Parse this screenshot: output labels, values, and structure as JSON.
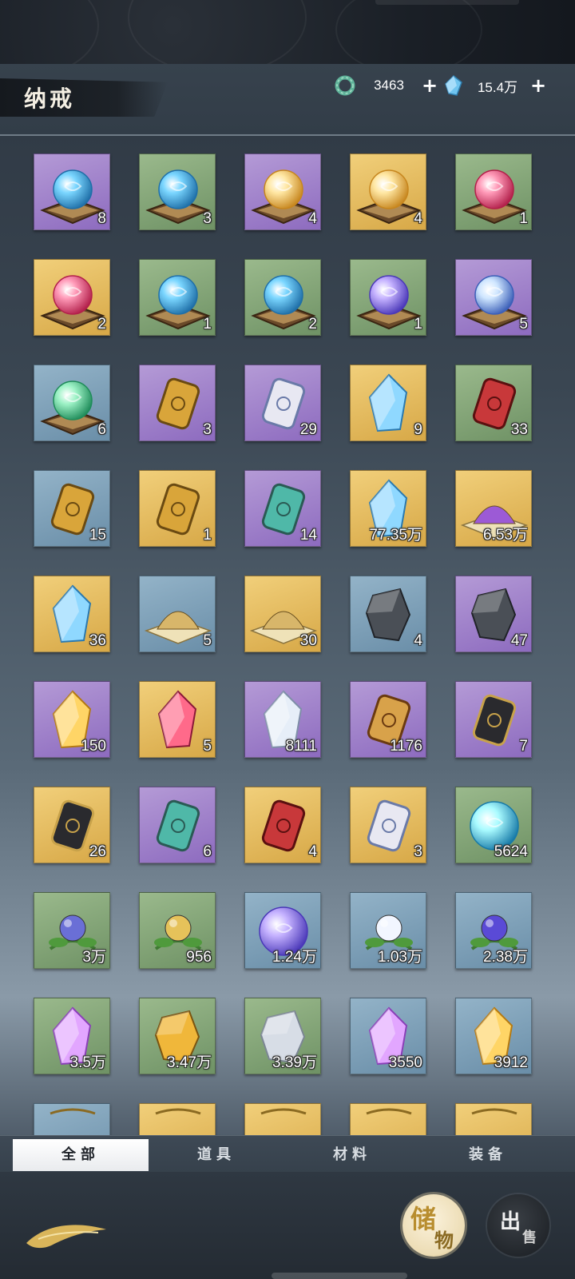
{
  "header": {
    "title": "纳戒",
    "currencies": [
      {
        "icon": "jade-ring-icon",
        "value": "3463"
      },
      {
        "icon": "blue-crystal-icon",
        "value": "15.4万"
      }
    ],
    "plus_label": "+"
  },
  "rows": [
    [
      {
        "bg": "purple",
        "icon": "blue-swirl-orb-icon",
        "count": "8"
      },
      {
        "bg": "green",
        "icon": "blue-orb-icon",
        "count": "3"
      },
      {
        "bg": "purple",
        "icon": "golden-lotus-orb-icon",
        "count": "4"
      },
      {
        "bg": "gold",
        "icon": "yin-yang-orb-icon",
        "count": "4"
      },
      {
        "bg": "green",
        "icon": "pink-swirl-orb-icon",
        "count": "1"
      }
    ],
    [
      {
        "bg": "gold",
        "icon": "red-sword-orb-icon",
        "count": "2"
      },
      {
        "bg": "green",
        "icon": "blue-shield-orb-icon",
        "count": "1"
      },
      {
        "bg": "green",
        "icon": "blue-shield-orb-icon",
        "count": "2"
      },
      {
        "bg": "green",
        "icon": "purple-rune-orb-icon",
        "count": "1"
      },
      {
        "bg": "purple",
        "icon": "meditation-orb-icon",
        "count": "5"
      }
    ],
    [
      {
        "bg": "blue",
        "icon": "green-swirl-orb-icon",
        "count": "6"
      },
      {
        "bg": "purple",
        "icon": "golden-bells-icon",
        "count": "3"
      },
      {
        "bg": "purple",
        "icon": "feather-charm-icon",
        "count": "29"
      },
      {
        "bg": "gold",
        "icon": "crystal-ball-stand-icon",
        "count": "9"
      },
      {
        "bg": "green",
        "icon": "red-pouch-icon",
        "count": "33"
      }
    ],
    [
      {
        "bg": "blue",
        "icon": "golden-comb-icon",
        "count": "15"
      },
      {
        "bg": "gold",
        "icon": "golden-hairpin-icon",
        "count": "1"
      },
      {
        "bg": "purple",
        "icon": "jade-pendant-icon",
        "count": "14"
      },
      {
        "bg": "gold",
        "icon": "ice-crystal-shard-icon",
        "count": "77.35万"
      },
      {
        "bg": "gold",
        "icon": "purple-powder-box-icon",
        "count": "6.53万"
      }
    ],
    [
      {
        "bg": "gold",
        "icon": "blue-crystal-icon",
        "count": "36"
      },
      {
        "bg": "blue",
        "icon": "sand-pile-icon",
        "count": "5"
      },
      {
        "bg": "gold",
        "icon": "sand-pile-icon",
        "count": "30"
      },
      {
        "bg": "blue",
        "icon": "black-ore-icon",
        "count": "4"
      },
      {
        "bg": "purple",
        "icon": "black-ore-icon",
        "count": "47"
      }
    ],
    [
      {
        "bg": "purple",
        "icon": "gold-ore-crystal-icon",
        "count": "150"
      },
      {
        "bg": "gold",
        "icon": "red-crystal-flower-icon",
        "count": "5"
      },
      {
        "bg": "purple",
        "icon": "silver-crystal-icon",
        "count": "8111"
      },
      {
        "bg": "purple",
        "icon": "scroll-talisman-icon",
        "count": "1176"
      },
      {
        "bg": "purple",
        "icon": "black-token-icon",
        "count": "7"
      }
    ],
    [
      {
        "bg": "gold",
        "icon": "bagua-disc-icon",
        "count": "26"
      },
      {
        "bg": "purple",
        "icon": "jade-tablet-icon",
        "count": "6"
      },
      {
        "bg": "gold",
        "icon": "red-token-icon",
        "count": "4"
      },
      {
        "bg": "gold",
        "icon": "feather-scythe-icon",
        "count": "3"
      },
      {
        "bg": "green",
        "icon": "cyan-dragon-orb-icon",
        "count": "5624"
      }
    ],
    [
      {
        "bg": "green",
        "icon": "blue-flower-icon",
        "count": "3万"
      },
      {
        "bg": "green",
        "icon": "golden-fruit-icon",
        "count": "956"
      },
      {
        "bg": "blue",
        "icon": "purple-energy-orb-icon",
        "count": "1.24万"
      },
      {
        "bg": "blue",
        "icon": "white-lotus-icon",
        "count": "1.03万"
      },
      {
        "bg": "blue",
        "icon": "purple-berries-icon",
        "count": "2.38万"
      }
    ],
    [
      {
        "bg": "green",
        "icon": "pink-gem-icon",
        "count": "3.5万"
      },
      {
        "bg": "green",
        "icon": "gold-nugget-icon",
        "count": "3.47万"
      },
      {
        "bg": "green",
        "icon": "silver-ore-icon",
        "count": "3.39万"
      },
      {
        "bg": "blue",
        "icon": "violet-crystal-icon",
        "count": "3550"
      },
      {
        "bg": "blue",
        "icon": "flaming-gold-crystal-icon",
        "count": "3912"
      }
    ],
    [
      {
        "bg": "blue",
        "icon": "partial-item-icon",
        "count": ""
      },
      {
        "bg": "gold",
        "icon": "partial-item-icon",
        "count": ""
      },
      {
        "bg": "gold",
        "icon": "partial-item-icon",
        "count": ""
      },
      {
        "bg": "gold",
        "icon": "partial-item-icon",
        "count": ""
      },
      {
        "bg": "gold",
        "icon": "partial-item-icon",
        "count": ""
      }
    ]
  ],
  "tabs": [
    "全部",
    "道具",
    "材料",
    "装备"
  ],
  "active_tab": 0,
  "actions": {
    "store": {
      "char1": "储",
      "char2": "物"
    },
    "sell": {
      "char1": "出",
      "char2": "售"
    }
  }
}
